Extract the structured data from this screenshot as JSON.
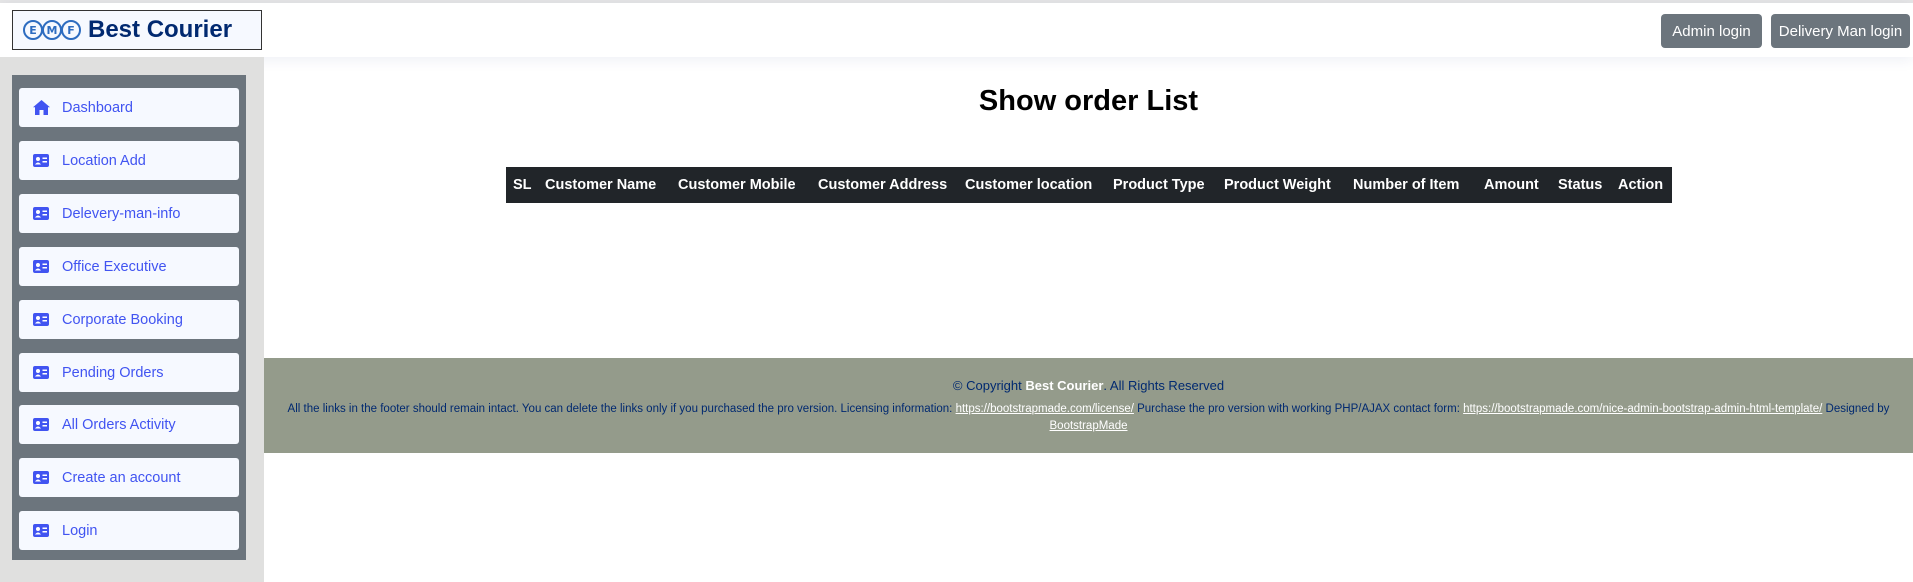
{
  "brand": {
    "logo_letters": [
      "E",
      "M",
      "F"
    ],
    "name": "Best Courier"
  },
  "header": {
    "admin_login": "Admin login",
    "delivery_login": "Delivery Man login"
  },
  "sidebar": {
    "items": [
      {
        "label": "Dashboard",
        "icon": "home-icon"
      },
      {
        "label": "Location Add",
        "icon": "id-card-icon"
      },
      {
        "label": "Delevery-man-info",
        "icon": "id-card-icon"
      },
      {
        "label": "Office Executive",
        "icon": "id-card-icon"
      },
      {
        "label": "Corporate Booking",
        "icon": "id-card-icon"
      },
      {
        "label": "Pending Orders",
        "icon": "id-card-icon"
      },
      {
        "label": "All Orders Activity",
        "icon": "id-card-icon"
      },
      {
        "label": "Create an account",
        "icon": "id-card-icon"
      },
      {
        "label": "Login",
        "icon": "id-card-icon"
      }
    ]
  },
  "main": {
    "title": "Show order List",
    "table": {
      "columns": [
        "SL",
        "Customer Name",
        "Customer Mobile",
        "Customer Address",
        "Customer location",
        "Product Type",
        "Product Weight",
        "Number of Item",
        "Amount",
        "Status",
        "Action"
      ],
      "rows": []
    }
  },
  "footer": {
    "copyright_prefix": "© Copyright ",
    "copyright_brand": "Best Courier",
    "copyright_suffix": ". All Rights Reserved",
    "credits_text_1": "All the links in the footer should remain intact. You can delete the links only if you purchased the pro version. Licensing information: ",
    "license_link": "https://bootstrapmade.com/license/",
    "credits_text_2": " Purchase the pro version with working PHP/AJAX contact form: ",
    "template_link": "https://bootstrapmade.com/nice-admin-bootstrap-admin-html-template/",
    "credits_text_3": " Designed by ",
    "designer_link": "BootstrapMade"
  },
  "colors": {
    "accent": "#4154f1",
    "brand_text": "#012970",
    "button_gray": "#6c757d",
    "table_head": "#212529",
    "footer_bg": "#949b8b"
  }
}
